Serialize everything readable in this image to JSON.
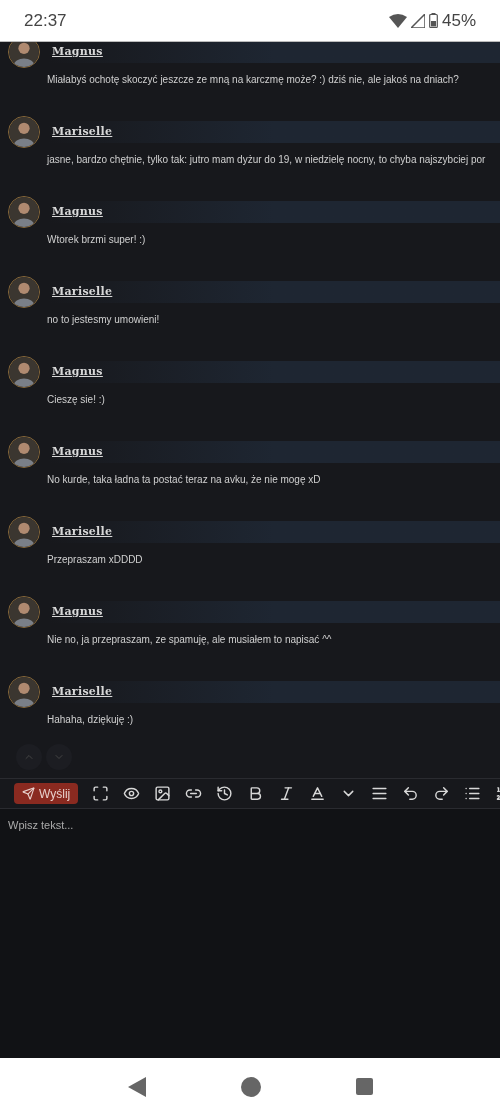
{
  "status_bar": {
    "time": "22:37",
    "battery": "45%"
  },
  "messages": [
    {
      "author": "Magnus",
      "text": "Miałabyś ochotę skoczyć jeszcze ze mną na karczmę może? :) dziś nie, ale jakoś na dniach?"
    },
    {
      "author": "Mariselle",
      "text": "jasne, bardzo chętnie, tylko tak: jutro mam dyżur do 19, w niedzielę nocny, to chyba najszybciej por"
    },
    {
      "author": "Magnus",
      "text": "Wtorek brzmi super! :)"
    },
    {
      "author": "Mariselle",
      "text": "no to jestesmy umowieni!"
    },
    {
      "author": "Magnus",
      "text": "Cieszę sie! :)"
    },
    {
      "author": "Magnus",
      "text": "No kurde, taka ładna ta postać teraz na avku, że nie mogę xD"
    },
    {
      "author": "Mariselle",
      "text": "Przepraszam xDDDD"
    },
    {
      "author": "Magnus",
      "text": "Nie no, ja przepraszam, ze spamuję, ale musiałem to napisać ^^"
    },
    {
      "author": "Mariselle",
      "text": "Hahaha, dziękuję :)"
    }
  ],
  "editor": {
    "send_label": "Wyślij",
    "placeholder": "Wpisz tekst..."
  }
}
